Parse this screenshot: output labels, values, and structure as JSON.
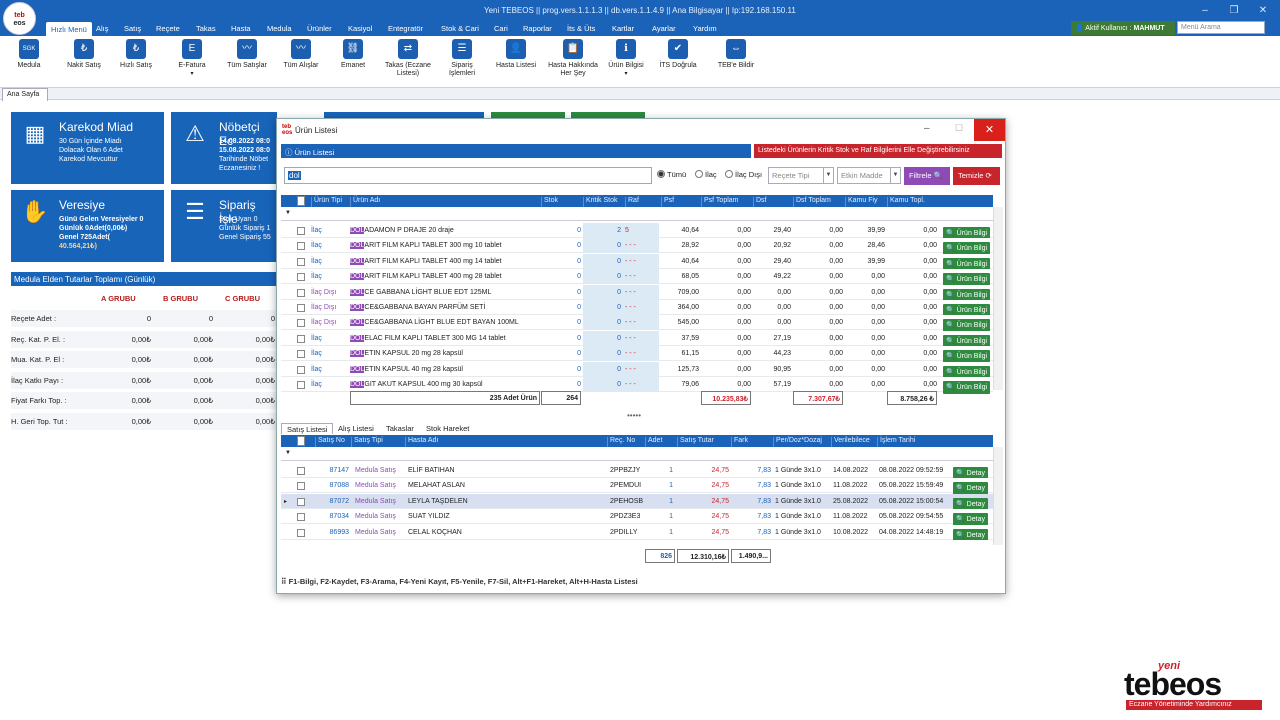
{
  "window": {
    "title": "Yeni TEBEOS  || prog.vers.1.1.1.3  || db.vers.1.1.4.9  || Ana Bilgisayar  || Ip:192.168.150.11",
    "logo_top": "teb",
    "logo_bottom": "eos"
  },
  "menu": [
    "Hızlı Menü",
    "Alış",
    "Satış",
    "Reçete",
    "Takas",
    "Hasta",
    "Medula",
    "Ürünler",
    "Kasiyol",
    "Entegratör",
    "Stok & Cari",
    "Cari",
    "Raporlar",
    "İts & Üts",
    "Kartlar",
    "Ayarlar",
    "Yardım"
  ],
  "user": {
    "label": "Aktif Kullanıcı :",
    "name": "MAHMUT"
  },
  "search": {
    "placeholder": "Menü Arama"
  },
  "ribbon": [
    {
      "label": "Medula",
      "icon": "sgk-icon"
    },
    {
      "label": "Nakit Satış",
      "icon": "lira-icon"
    },
    {
      "label": "Hızlı Satış",
      "icon": "fast-sale-icon"
    },
    {
      "label": "E-Fatura",
      "icon": "invoice-icon"
    },
    {
      "label": "Tüm Satışlar",
      "icon": "sales-chart-icon"
    },
    {
      "label": "Tüm Alışlar",
      "icon": "purchase-chart-icon"
    },
    {
      "label": "Emanet",
      "icon": "link-icon"
    },
    {
      "label": "Takas (Eczane Listesi)",
      "icon": "swap-icon"
    },
    {
      "label": "Sipariş İşlemleri",
      "icon": "order-list-icon"
    },
    {
      "label": "Hasta Listesi",
      "icon": "patient-icon"
    },
    {
      "label": "Hasta Hakkında Her Şey",
      "icon": "patient-info-icon"
    },
    {
      "label": "Ürün Bilgisi",
      "icon": "product-info-icon"
    },
    {
      "label": "İTS Doğrula",
      "icon": "shield-check-icon"
    },
    {
      "label": "TEB'e Bildir",
      "icon": "report-icon"
    }
  ],
  "doctab": "Ana Sayfa",
  "tiles": {
    "karekod": {
      "title": "Karekod Miad",
      "lines": [
        "30 Gün İçinde Miadı",
        "Dolacak Olan 6 Adet",
        "Karekod Mevcuttur"
      ]
    },
    "nobetci": {
      "title": "Nöbetçi Ec",
      "lines": [
        "14.08.2022 08:0",
        "15.08.2022 08:0",
        "Tarihinde Nöbet",
        "Eczanesiniz !"
      ]
    },
    "veresiye": {
      "title": "Veresiye",
      "lines": [
        "Günü Gelen Veresiyeler 0",
        "Günlük 0Adet(0,00₺)",
        "Genel 725Adet(",
        "40.564,21₺)"
      ]
    },
    "siparis": {
      "title": "Sipariş İşle",
      "lines": [
        "Stok Uyarı 0",
        "Günlük Sipariş 1",
        "Genel Sipariş 55"
      ]
    }
  },
  "medula": {
    "header": "Medula Elden Tutarlar Toplamı (Günlük)",
    "groups": [
      "A GRUBU",
      "B GRUBU",
      "C GRUBU"
    ],
    "rows": [
      {
        "label": "Reçete Adet :",
        "vals": [
          "0",
          "0",
          "0"
        ]
      },
      {
        "label": "Reç. Kat. P. El. :",
        "vals": [
          "0,00₺",
          "0,00₺",
          "0,00₺"
        ]
      },
      {
        "label": "Mua. Kat. P. El :",
        "vals": [
          "0,00₺",
          "0,00₺",
          "0,00₺"
        ]
      },
      {
        "label": "İlaç Katkı Payı :",
        "vals": [
          "0,00₺",
          "0,00₺",
          "0,00₺"
        ]
      },
      {
        "label": "Fiyat Farkı Top. :",
        "vals": [
          "0,00₺",
          "0,00₺",
          "0,00₺"
        ]
      },
      {
        "label": "H. Geri Top. Tut :",
        "vals": [
          "0,00₺",
          "0,00₺",
          "0,00₺"
        ]
      }
    ]
  },
  "dialog": {
    "title": "Ürün Listesi",
    "info": "Ürün Listesi",
    "red_notice": "Listedeki Ürünlerin Kritik Stok ve Raf Bilgilerini Elle Değiştirebilirsiniz",
    "search_value": "dol",
    "radios": [
      "Tümü",
      "İlaç",
      "İlaç Dışı"
    ],
    "recete_placeholder": "Reçete Tipi",
    "etkin_placeholder": "Etkin Madde",
    "filter_label": "Filtrele",
    "clear_label": "Temizle",
    "columns": [
      "Ürün Tipi",
      "Ürün Adı",
      "Stok",
      "Kritik Stok",
      "Raf",
      "Psf",
      "Psf Toplam",
      "Dsf",
      "Dsf Toplam",
      "Kamu Fiy",
      "Kamu Topl."
    ],
    "rows": [
      {
        "tip": "İlaç",
        "pre": "DOL",
        "name": "ADAMON P DRAJE  20 draje",
        "stok": "0",
        "kritik": "2",
        "raf": "5",
        "psf": "40,64",
        "psft": "0,00",
        "dsf": "29,40",
        "dsft": "0,00",
        "kamu": "39,99",
        "kamut": "0,00"
      },
      {
        "tip": "İlaç",
        "pre": "DOL",
        "name": "ARIT FILM KAPLI TABLET 300 mg 10 tablet",
        "stok": "0",
        "kritik": "0",
        "raf": "- - -",
        "psf": "28,92",
        "psft": "0,00",
        "dsf": "20,92",
        "dsft": "0,00",
        "kamu": "28,46",
        "kamut": "0,00"
      },
      {
        "tip": "İlaç",
        "pre": "DOL",
        "name": "ARIT FILM KAPLI TABLET 400 mg 14 tablet",
        "stok": "0",
        "kritik": "0",
        "raf": "- - -",
        "psf": "40,64",
        "psft": "0,00",
        "dsf": "29,40",
        "dsft": "0,00",
        "kamu": "39,99",
        "kamut": "0,00"
      },
      {
        "tip": "İlaç",
        "pre": "DOL",
        "name": "ARIT FILM KAPLI TABLET 400 mg 28 tablet",
        "stok": "0",
        "kritik": "0",
        "raf": "- - -",
        "psf": "68,05",
        "psft": "0,00",
        "dsf": "49,22",
        "dsft": "0,00",
        "kamu": "0,00",
        "kamut": "0,00"
      },
      {
        "tip": "İlaç Dışı",
        "pre": "DOL",
        "name": "CE GABBANA LİGHT BLUE EDT 125ML",
        "stok": "0",
        "kritik": "0",
        "raf": "- - -",
        "psf": "709,00",
        "psft": "0,00",
        "dsf": "0,00",
        "dsft": "0,00",
        "kamu": "0,00",
        "kamut": "0,00"
      },
      {
        "tip": "İlaç Dışı",
        "pre": "DOL",
        "name": "CE&GABBANA BAYAN PARFÜM SETİ",
        "stok": "0",
        "kritik": "0",
        "raf": "- - -",
        "psf": "364,00",
        "psft": "0,00",
        "dsf": "0,00",
        "dsft": "0,00",
        "kamu": "0,00",
        "kamut": "0,00"
      },
      {
        "tip": "İlaç Dışı",
        "pre": "DOL",
        "name": "CE&GABBANA LİGHT BLUE EDT BAYAN 100ML",
        "stok": "0",
        "kritik": "0",
        "raf": "- - -",
        "psf": "545,00",
        "psft": "0,00",
        "dsf": "0,00",
        "dsft": "0,00",
        "kamu": "0,00",
        "kamut": "0,00"
      },
      {
        "tip": "İlaç",
        "pre": "DOL",
        "name": "ELAC FILM KAPLI TABLET 300 MG 14 tablet",
        "stok": "0",
        "kritik": "0",
        "raf": "- - -",
        "psf": "37,59",
        "psft": "0,00",
        "dsf": "27,19",
        "dsft": "0,00",
        "kamu": "0,00",
        "kamut": "0,00"
      },
      {
        "tip": "İlaç",
        "pre": "DOL",
        "name": "ETIN KAPSUL 20 mg 28 kapsül",
        "stok": "0",
        "kritik": "0",
        "raf": "- - -",
        "psf": "61,15",
        "psft": "0,00",
        "dsf": "44,23",
        "dsft": "0,00",
        "kamu": "0,00",
        "kamut": "0,00"
      },
      {
        "tip": "İlaç",
        "pre": "DOL",
        "name": "ETIN KAPSUL 40 mg 28 kapsül",
        "stok": "0",
        "kritik": "0",
        "raf": "- - -",
        "psf": "125,73",
        "psft": "0,00",
        "dsf": "90,95",
        "dsft": "0,00",
        "kamu": "0,00",
        "kamut": "0,00"
      },
      {
        "tip": "İlaç",
        "pre": "DOL",
        "name": "GIT AKUT KAPSUL 400 mg 30 kapsül",
        "stok": "0",
        "kritik": "0",
        "raf": "- - -",
        "psf": "79,06",
        "psft": "0,00",
        "dsf": "57,19",
        "dsft": "0,00",
        "kamu": "0,00",
        "kamut": "0,00"
      }
    ],
    "info_button": "Ürün Bilgi",
    "footer": {
      "count": "235 Adet Ürün",
      "stok": "264",
      "psft": "10.235,83₺",
      "dsft": "7.307,67₺",
      "kamut": "8.758,26 ₺"
    },
    "bottom_tabs": [
      "Satış Listesi",
      "Alış Listesi",
      "Takaslar",
      "Stok Hareket"
    ],
    "sales_columns": [
      "Satış No",
      "Satış Tipi",
      "Hasta Adı",
      "Reç. No",
      "Adet",
      "Satış Tutar",
      "Fark",
      "Per/Doz*Dozaj",
      "Verilebilece",
      "İşlem Tarihi"
    ],
    "sales": [
      {
        "no": "87147",
        "tip": "Medula Satış",
        "hasta": "ELİF BATIHAN",
        "rec": "2PPBZJY",
        "adet": "1",
        "tutar": "24,75",
        "fark": "7,83",
        "doz": "1 Günde 3x1.0",
        "ver": "14.08.2022",
        "tarih": "08.08.2022 09:52:59"
      },
      {
        "no": "87088",
        "tip": "Medula Satış",
        "hasta": "MELAHAT ASLAN",
        "rec": "2PEMDUI",
        "adet": "1",
        "tutar": "24,75",
        "fark": "7,83",
        "doz": "1 Günde 3x1.0",
        "ver": "11.08.2022",
        "tarih": "05.08.2022 15:59:49"
      },
      {
        "no": "87072",
        "tip": "Medula Satış",
        "hasta": "LEYLA TAŞDELEN",
        "rec": "2PEHOSB",
        "adet": "1",
        "tutar": "24,75",
        "fark": "7,83",
        "doz": "1 Günde 3x1.0",
        "ver": "25.08.2022",
        "tarih": "05.08.2022 15:00:54"
      },
      {
        "no": "87034",
        "tip": "Medula Satış",
        "hasta": "SUAT YILDIZ",
        "rec": "2PDZ3E3",
        "adet": "1",
        "tutar": "24,75",
        "fark": "7,83",
        "doz": "1 Günde 3x1.0",
        "ver": "11.08.2022",
        "tarih": "05.08.2022 09:54:55"
      },
      {
        "no": "86993",
        "tip": "Medula Satış",
        "hasta": "CELAL KOÇHAN",
        "rec": "2PDILLY",
        "adet": "1",
        "tutar": "24,75",
        "fark": "7,83",
        "doz": "1 Günde 3x1.0",
        "ver": "10.08.2022",
        "tarih": "04.08.2022 14:48:19"
      }
    ],
    "detail_button": "Detay",
    "sales_footer": {
      "adet": "826",
      "tutar": "12.310,16₺",
      "fark": "1.490,9..."
    },
    "shortcuts": "F1-Bilgi, F2-Kaydet, F3-Arama, F4-Yeni Kayıt, F5-Yenile, F7-Sil, Alt+F1-Hareket, Alt+H-Hasta Listesi"
  },
  "brand": {
    "top": "yeni",
    "name": "tebeos",
    "tagline": "Eczane Yönetiminde Yardımcınız"
  }
}
